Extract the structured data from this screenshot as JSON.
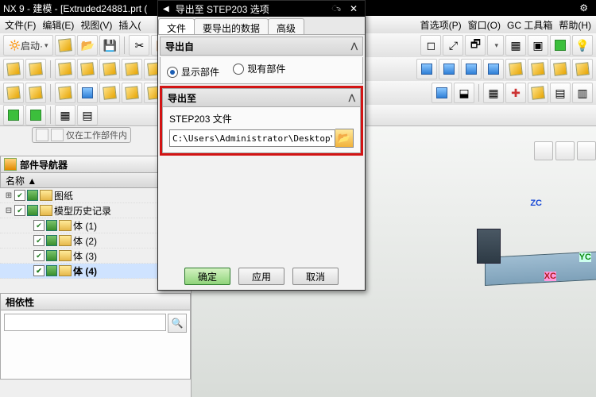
{
  "title": "NX 9 - 建模 - [Extruded24881.prt (",
  "menu": {
    "file": "文件(F)",
    "edit": "编辑(E)",
    "view": "视图(V)",
    "insert": "插入(",
    "pref": "首选项(P)",
    "window": "窗口(O)",
    "gctool": "GC 工具箱",
    "help": "帮助(H)"
  },
  "launch_label": "启动·",
  "badge": "仅在工作部件内",
  "nav": {
    "title": "部件导航器",
    "col": "名称 ▲",
    "items": [
      {
        "exp": "⊞",
        "label": "图纸",
        "indent": 0,
        "sel": false
      },
      {
        "exp": "⊟",
        "label": "模型历史记录",
        "indent": 0,
        "sel": false
      },
      {
        "exp": "",
        "label": "体   (1)",
        "indent": 1,
        "sel": false
      },
      {
        "exp": "",
        "label": "体   (2)",
        "indent": 1,
        "sel": false
      },
      {
        "exp": "",
        "label": "体   (3)",
        "indent": 1,
        "sel": false
      },
      {
        "exp": "",
        "label": "体   (4)",
        "indent": 1,
        "sel": true
      }
    ],
    "deps_title": "相依性"
  },
  "dlg": {
    "title": "导出至  STEP203  选项",
    "tabs": {
      "t0": "文件",
      "t1": "要导出的数据",
      "t2": "高级"
    },
    "from": {
      "hdr": "导出自",
      "r0": "显示部件",
      "r1": "现有部件"
    },
    "to": {
      "hdr": "导出至",
      "lbl": "STEP203 文件",
      "path": "C:\\Users\\Administrator\\Desktop\\pho"
    },
    "btn": {
      "ok": "确定",
      "apply": "应用",
      "cancel": "取消"
    }
  },
  "axis": {
    "x": "XC",
    "y": "YC",
    "z": "ZC"
  }
}
